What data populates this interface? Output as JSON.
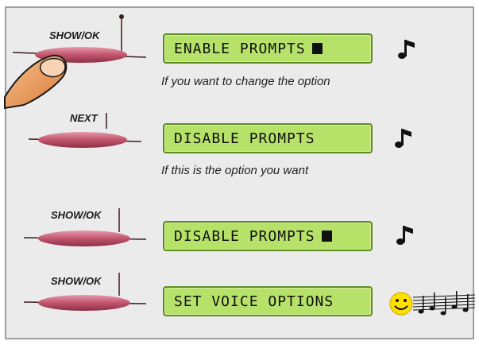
{
  "steps": [
    {
      "button": "SHOW/OK",
      "display": "ENABLE PROMPTS",
      "caption": "If you want to change the option",
      "icon": "music-note-icon"
    },
    {
      "button": "NEXT",
      "display": "DISABLE PROMPTS",
      "caption": "If this is the option you want",
      "icon": "music-note-icon"
    },
    {
      "button": "SHOW/OK",
      "display": "DISABLE PROMPTS",
      "caption": "",
      "icon": "music-note-icon"
    },
    {
      "button": "SHOW/OK",
      "display": "SET VOICE OPTIONS",
      "caption": "",
      "icon": "smiley-music-icon"
    }
  ],
  "colors": {
    "lcd": "#b7e26a",
    "lcd_border": "#5e8c24",
    "button": "#c45a6f",
    "finger": "#e89a55"
  }
}
